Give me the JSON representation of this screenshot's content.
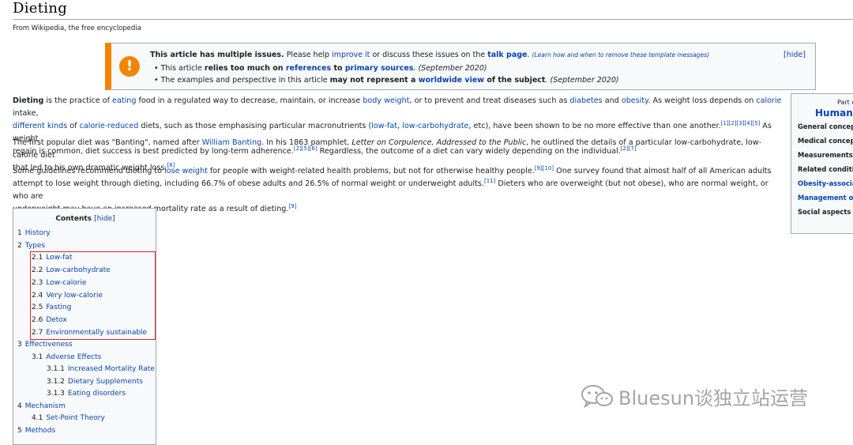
{
  "page": {
    "title": "Dieting",
    "tagline": "From Wikipedia, the free encyclopedia"
  },
  "ambox": {
    "icon": "!",
    "head_bold": "This article has multiple issues.",
    "head_mid": " Please help ",
    "head_link1": "improve it",
    "head_mid2": " or discuss these issues on the ",
    "head_link2": "talk page",
    "head_dot": ". ",
    "head_small": "(Learn how and when to remove these template messages)",
    "hide": "[hide]",
    "issue1_pre": "This article ",
    "issue1_bold": "relies too much on ",
    "issue1_link1": "references",
    "issue1_to": " to ",
    "issue1_link2": "primary sources",
    "issue1_date": ". (September 2020)",
    "issue2_pre": "The examples and perspective in this article ",
    "issue2_bold": "may not represent a ",
    "issue2_link": "worldwide view",
    "issue2_bold2": " of the subject",
    "issue2_date": ". (September 2020)"
  },
  "article": {
    "p1": {
      "b": "Dieting",
      "t1": " is the practice of ",
      "l_eating": "eating",
      "t2": " food in a regulated way to decrease, maintain, or increase ",
      "l_body_weight": "body weight",
      "t3": ", or to prevent and treat diseases such as ",
      "l_diabetes": "diabetes",
      "t4": " and ",
      "l_obesity": "obesity",
      "t5": ". As weight loss depends on ",
      "l_calorie": "calorie",
      "t6": " intake,",
      "l_different": "different",
      "l_kinds": "kinds",
      "t7": " of ",
      "l_calorie_reduced": "calorie-reduced",
      "t8": " diets, such as those emphasising particular macronutrients (",
      "l_low_fat": "low-fat",
      "t9": ", ",
      "l_low_carb": "low-carbohydrate",
      "t10": ", etc), have been shown to be no more effective than one another.",
      "ref1": "[1][2][3][4][5]",
      "t11": " As weight",
      "t12": "regain is common, diet success is best predicted by long-term adherence.",
      "ref2": "[2][5][6]",
      "t13": " Regardless, the outcome of a diet can vary widely depending on the individual.",
      "ref3": "[2][7]"
    },
    "p2": {
      "t1": "The first popular diet was \"Banting\", named after ",
      "l_banting": "William Banting",
      "t2": ". In his 1863 pamphlet, ",
      "i_letter": "Letter on Corpulence, Addressed to the Public",
      "t3": ", he outlined the details of a particular low-carbohydrate, low-calorie diet",
      "t4": "that led to his own dramatic weight loss.",
      "ref": "[8]"
    },
    "p3": {
      "t1": "Some guidelines recommend dieting to ",
      "l_lose_weight": "lose weight",
      "t2": " for people with weight-related health problems, but not for otherwise healthy people.",
      "ref1": "[9][10]",
      "t3": " One survey found that almost half of all American adults",
      "t4": "attempt to lose weight through dieting, including 66.7% of obese adults and 26.5% of normal weight or underweight adults.",
      "ref2": "[11]",
      "t5": " Dieters who are overweight (but not obese), who are normal weight, or who are",
      "t6": "underweight may have an increased mortality rate as a result of dieting.",
      "ref3": "[9]"
    }
  },
  "sidebar": {
    "part": "Part o",
    "title": "Human",
    "items": [
      {
        "label": "General concep",
        "link": false
      },
      {
        "label": "Medical concep",
        "link": false
      },
      {
        "label": "Measurements",
        "link": false
      },
      {
        "label": "Related conditio",
        "link": false
      },
      {
        "label": "Obesity-associa",
        "link": true
      },
      {
        "label": "Management of",
        "link": true
      },
      {
        "label": "Social aspects",
        "link": false
      }
    ]
  },
  "toc": {
    "title": "Contents",
    "hide": "[hide]",
    "entries": [
      {
        "num": "1",
        "label": "History"
      },
      {
        "num": "2",
        "label": "Types"
      },
      {
        "num": "2.1",
        "label": "Low-fat"
      },
      {
        "num": "2.2",
        "label": "Low-carbohydrate"
      },
      {
        "num": "2.3",
        "label": "Low-calorie"
      },
      {
        "num": "2.4",
        "label": "Very low-calorie"
      },
      {
        "num": "2.5",
        "label": "Fasting"
      },
      {
        "num": "2.6",
        "label": "Detox"
      },
      {
        "num": "2.7",
        "label": "Environmentally sustainable"
      },
      {
        "num": "3",
        "label": "Effectiveness"
      },
      {
        "num": "3.1",
        "label": "Adverse Effects"
      },
      {
        "num": "3.1.1",
        "label": "Increased Mortality Rate"
      },
      {
        "num": "3.1.2",
        "label": "Dietary Supplements"
      },
      {
        "num": "3.1.3",
        "label": "Eating disorders"
      },
      {
        "num": "4",
        "label": "Mechanism"
      },
      {
        "num": "4.1",
        "label": "Set-Point Theory"
      },
      {
        "num": "5",
        "label": "Methods"
      }
    ]
  },
  "watermark": {
    "text": "Bluesun谈独立站运营",
    "icon": "wechat-icon"
  },
  "colors": {
    "link": "#0645ad",
    "ambox_accent": "#f28500",
    "highlight": "#e0242b"
  }
}
